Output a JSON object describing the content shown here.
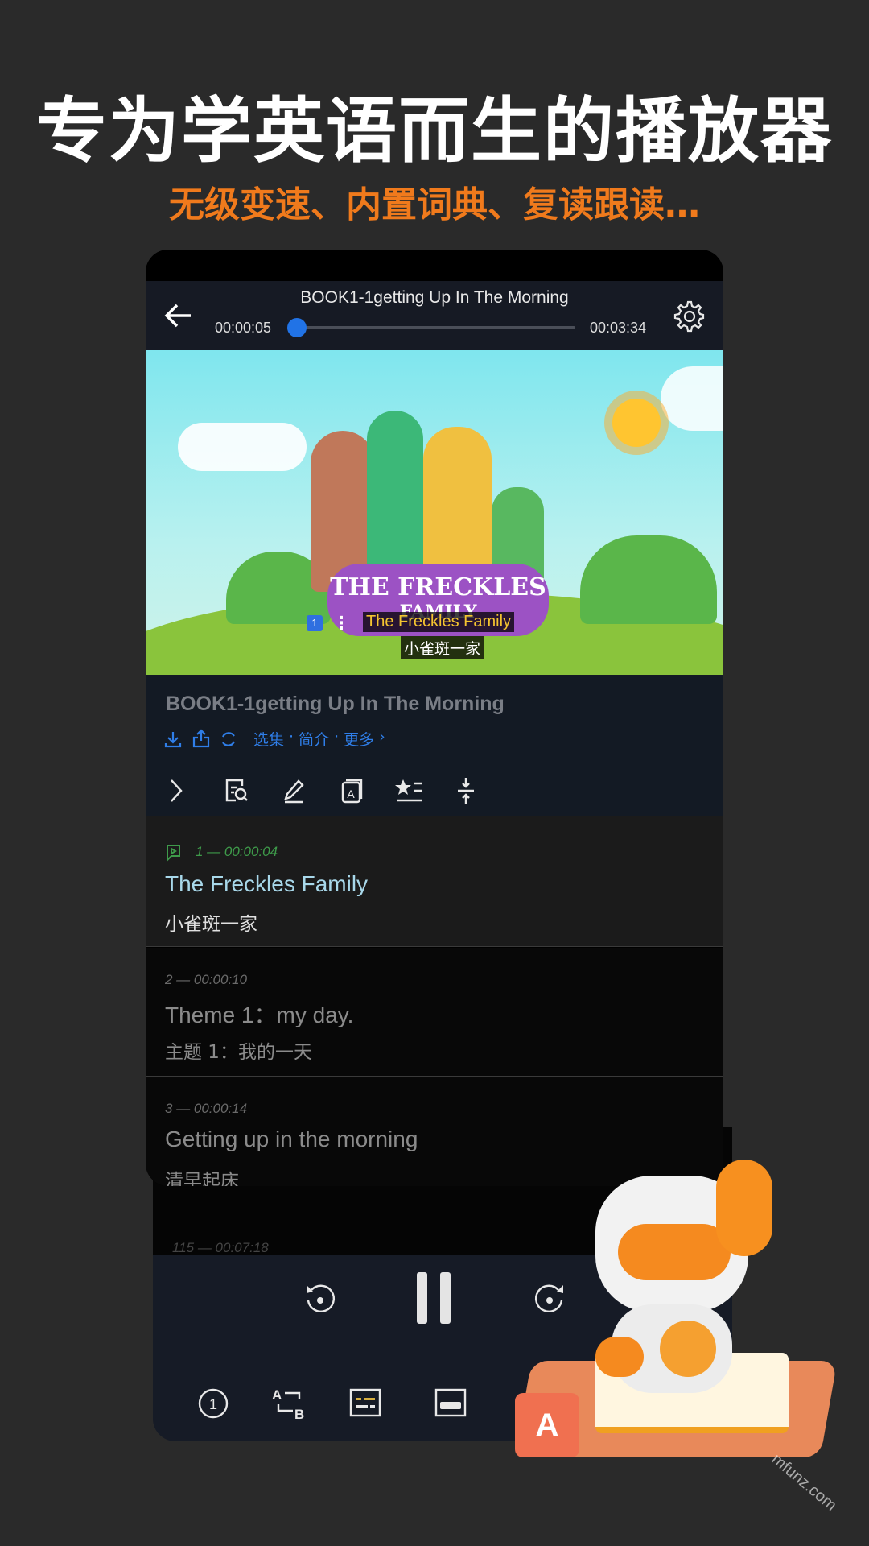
{
  "promo": {
    "headline": "专为学英语而生的播放器",
    "subline": "无级变速、内置词典、复读跟读…"
  },
  "header": {
    "title": "BOOK1-1getting Up In The Morning",
    "current_time": "00:00:05",
    "total_time": "00:03:34",
    "progress_percent": 2.3
  },
  "video": {
    "logo_line1": "THE FRECKLES",
    "logo_line2": "FAMILY",
    "subtitle_index": "1",
    "subtitle_en": "The Freckles Family",
    "subtitle_zh": "小雀斑一家"
  },
  "info": {
    "title": "BOOK1-1getting Up In The Morning",
    "links": [
      "选集",
      "简介",
      "更多"
    ],
    "separator": "·"
  },
  "subtitles": [
    {
      "meta": "1 — 00:00:04",
      "en": "The Freckles Family",
      "zh": "小雀斑一家",
      "active": true
    },
    {
      "meta": "2 — 00:00:10",
      "en": "Theme 1：my day.",
      "zh": "主题 1：我的一天"
    },
    {
      "meta": "3 — 00:00:14",
      "en": "Getting up in the morning",
      "zh": "清早起床"
    }
  ],
  "back_list": {
    "meta": "115 — 00:07:18"
  },
  "watermark": "mfunz.com",
  "colors": {
    "accent": "#2f7ee8",
    "active_text": "#a8d8ea",
    "active_meta": "#3e9a4a",
    "promo_orange": "#f07a1c"
  }
}
